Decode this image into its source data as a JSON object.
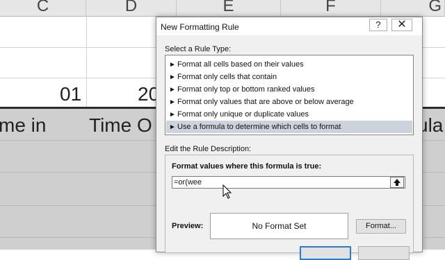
{
  "spreadsheet": {
    "columns": [
      "C",
      "D",
      "E",
      "F",
      "G"
    ],
    "cells": {
      "row1_c": "01",
      "row1_d": "20",
      "header_c": "me in",
      "header_d": "Time O",
      "header_g": "ula"
    }
  },
  "dialog": {
    "title": "New Formatting Rule",
    "help_label": "?",
    "close_label": "✕",
    "select_rule_label": "Select a Rule Type:",
    "rule_types": [
      "Format all cells based on their values",
      "Format only cells that contain",
      "Format only top or bottom ranked values",
      "Format only values that are above or below average",
      "Format only unique or duplicate values",
      "Use a formula to determine which cells to format"
    ],
    "selected_rule_index": 5,
    "edit_description_label": "Edit the Rule Description:",
    "formula_label": "Format values where this formula is true:",
    "formula_value": "=or(wee",
    "preview_label": "Preview:",
    "preview_text": "No Format Set",
    "format_button_label": "Format..."
  }
}
